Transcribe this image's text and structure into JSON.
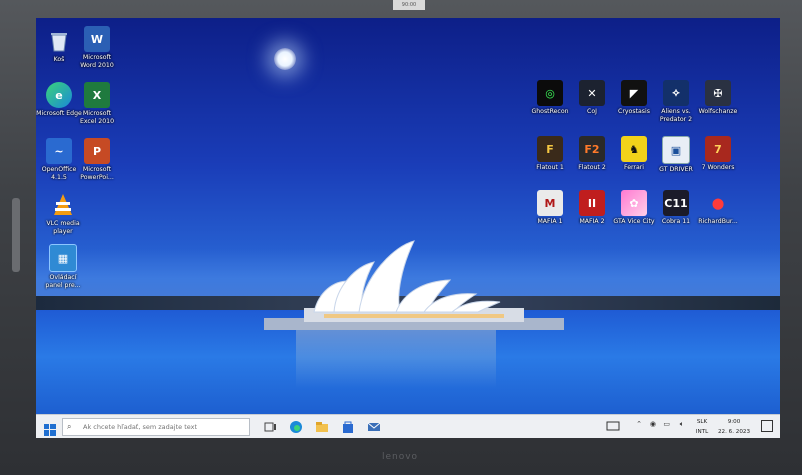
{
  "bezel": {
    "top_label": "90:00",
    "brand": "lenovo"
  },
  "desktop_left": [
    {
      "label": "Koš",
      "icon": "recycle-bin-icon"
    },
    {
      "label": "Microsoft Word 2010",
      "icon": "word-icon"
    },
    {
      "label": "Microsoft Edge",
      "icon": "edge-icon"
    },
    {
      "label": "Microsoft Excel 2010",
      "icon": "excel-icon"
    },
    {
      "label": "OpenOffice 4.1.5",
      "icon": "openoffice-icon"
    },
    {
      "label": "Microsoft PowerPoi...",
      "icon": "powerpoint-icon"
    },
    {
      "label": "VLC media player",
      "icon": "vlc-icon"
    },
    {
      "label": "Ovládací panel pre...",
      "icon": "control-panel-icon"
    }
  ],
  "desktop_right": [
    {
      "label": "GhostRecon",
      "icon": "ghostrecon-icon"
    },
    {
      "label": "CoJ",
      "icon": "coj-icon"
    },
    {
      "label": "Cryostasis",
      "icon": "cryostasis-icon"
    },
    {
      "label": "Aliens vs. Predator 2",
      "icon": "avp2-icon"
    },
    {
      "label": "Wolfschanze",
      "icon": "wolfschanze-icon"
    },
    {
      "label": "Flatout 1",
      "icon": "flatout1-icon"
    },
    {
      "label": "Flatout 2",
      "icon": "flatout2-icon"
    },
    {
      "label": "Ferrari",
      "icon": "ferrari-icon"
    },
    {
      "label": "GT DRIVER",
      "icon": "gtdriver-icon"
    },
    {
      "label": "7 Wonders",
      "icon": "7wonders-icon"
    },
    {
      "label": "MAFIA 1",
      "icon": "mafia1-icon"
    },
    {
      "label": "MAFIA 2",
      "icon": "mafia2-icon"
    },
    {
      "label": "GTA Vice City",
      "icon": "gta-vicecity-icon"
    },
    {
      "label": "Cobra 11",
      "icon": "cobra11-icon"
    },
    {
      "label": "RichardBur...",
      "icon": "richardburns-icon"
    }
  ],
  "taskbar": {
    "search_placeholder": "Ak chcete hľadať, sem zadajte text",
    "language_top": "SLK",
    "language_bottom": "INTL",
    "time": "9:00",
    "date": "22. 6. 2023"
  },
  "colors": {
    "taskbar_bg": "#eef0f3",
    "sky_top": "#0d1f88",
    "water": "#2a7ae6"
  }
}
